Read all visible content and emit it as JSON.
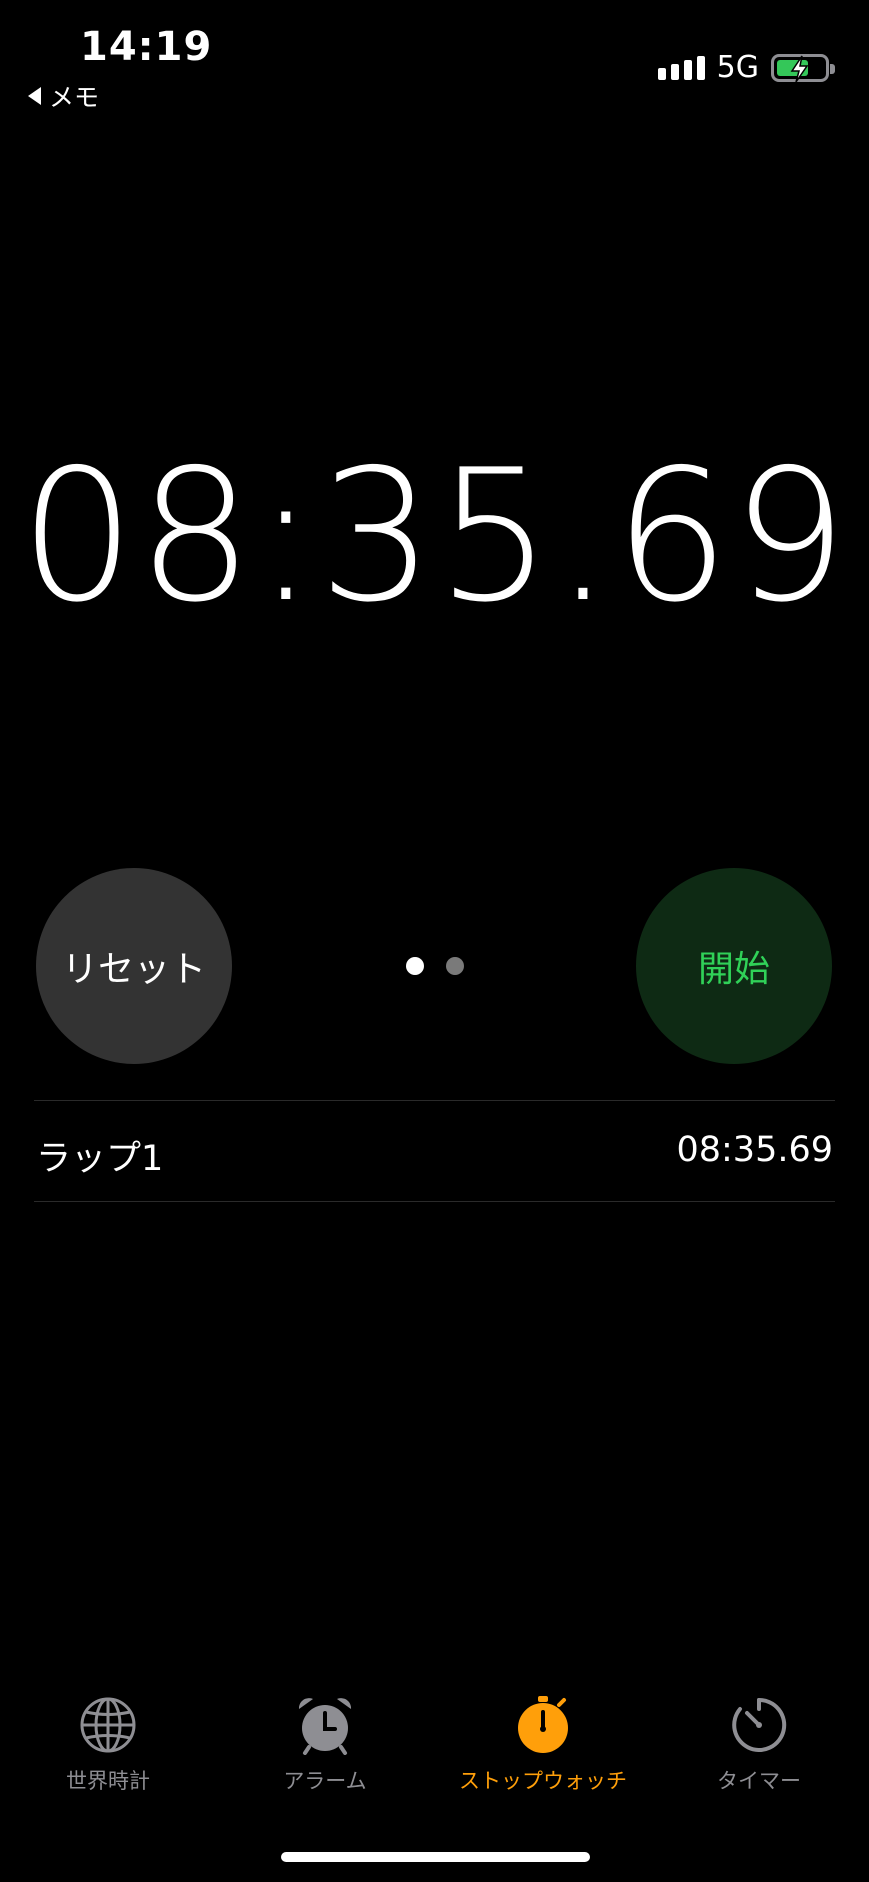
{
  "status_bar": {
    "time": "14:19",
    "back_label": "メモ",
    "network": "5G",
    "battery_color": "#34c759",
    "battery_level": 0.6
  },
  "stopwatch": {
    "display_time": "08:35.69",
    "reset_label": "リセット",
    "start_label": "開始",
    "start_color": "#30d158",
    "page_count": 2,
    "page_active": 1
  },
  "laps": [
    {
      "label": "ラップ1",
      "time": "08:35.69"
    }
  ],
  "tab_bar": {
    "active_color": "#ff9f0a",
    "tabs": [
      {
        "label": "世界時計",
        "icon": "globe-icon"
      },
      {
        "label": "アラーム",
        "icon": "alarm-clock-icon"
      },
      {
        "label": "ストップウォッチ",
        "icon": "stopwatch-icon"
      },
      {
        "label": "タイマー",
        "icon": "timer-icon"
      }
    ],
    "active_index": 2
  }
}
